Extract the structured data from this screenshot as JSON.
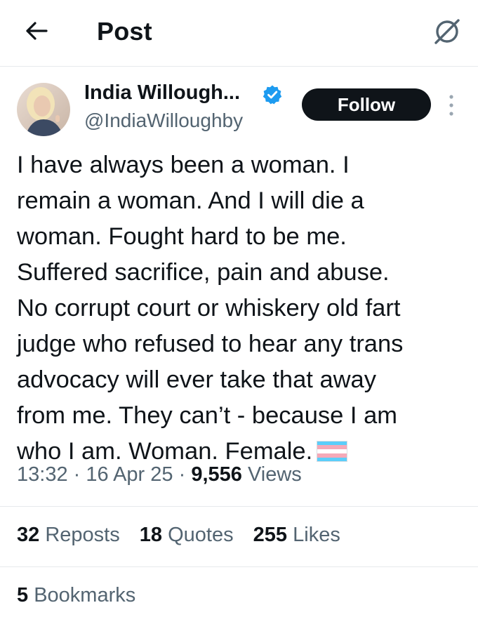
{
  "header": {
    "title": "Post",
    "back_icon": "arrow-left-icon",
    "grok_icon": "grok-icon"
  },
  "author": {
    "name": "India Willough...",
    "handle": "@IndiaWilloughby",
    "verified_color": "#1d9bf0",
    "follow_label": "Follow"
  },
  "tweet": {
    "lines": [
      "I have always been a woman. I",
      "remain a woman. And I will die a",
      "woman. Fought hard to be me.",
      "Suffered sacrifice, pain and abuse.",
      "No corrupt court or whiskery old fart",
      "judge who refused to hear any trans",
      "advocacy will ever take that away",
      "from me. They can’t - because I am",
      "who I am. Woman. Female."
    ],
    "emoji": "transgender-flag"
  },
  "meta": {
    "time": "13:32",
    "date": "16 Apr 25",
    "views_count": "9,556",
    "views_label": "Views",
    "separator": "·"
  },
  "stats": {
    "reposts_count": "32",
    "reposts_label": "Reposts",
    "quotes_count": "18",
    "quotes_label": "Quotes",
    "likes_count": "255",
    "likes_label": "Likes",
    "bookmarks_count": "5",
    "bookmarks_label": "Bookmarks"
  },
  "colors": {
    "text": "#0f1419",
    "secondary": "#536471",
    "divider": "#e6e9ec",
    "button": "#0f1419"
  }
}
